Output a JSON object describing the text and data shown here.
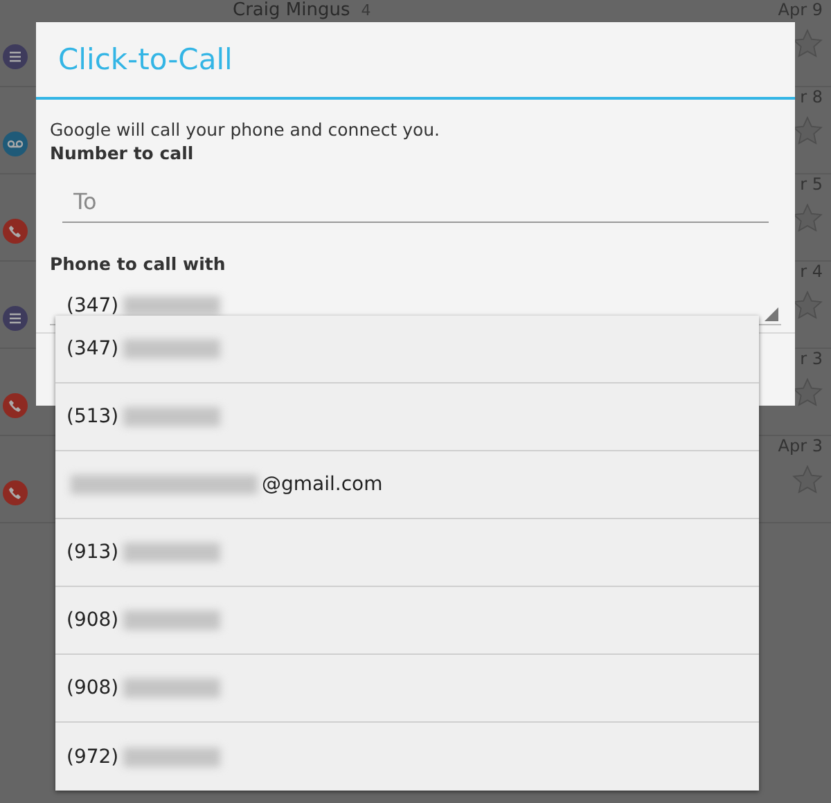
{
  "background_list": {
    "rows": [
      {
        "sender": "Craig Mingus",
        "count": "4",
        "date": "Apr 9",
        "kind": "note"
      },
      {
        "date": "r 8",
        "kind": "voicemail"
      },
      {
        "date": "r 5",
        "kind": "call"
      },
      {
        "date": "r 4",
        "kind": "note"
      },
      {
        "date": "r 3",
        "kind": "call"
      },
      {
        "date": "Apr 3",
        "kind": "call"
      }
    ]
  },
  "dialog": {
    "title": "Click-to-Call",
    "message": "Google will call your phone and connect you.",
    "number_label": "Number to call",
    "number_field": {
      "placeholder": "To"
    },
    "phone_label": "Phone to call with",
    "phone_spinner": {
      "value": "(347)",
      "kind": "phone"
    }
  },
  "dropdown": {
    "items": [
      {
        "text": "(347)",
        "kind": "phone"
      },
      {
        "text": "(513)",
        "kind": "phone"
      },
      {
        "text": "@gmail.com",
        "kind": "email"
      },
      {
        "text": "(913)",
        "kind": "phone"
      },
      {
        "text": "(908)",
        "kind": "phone"
      },
      {
        "text": "(908)",
        "kind": "phone"
      },
      {
        "text": "(972)",
        "kind": "phone"
      }
    ]
  }
}
